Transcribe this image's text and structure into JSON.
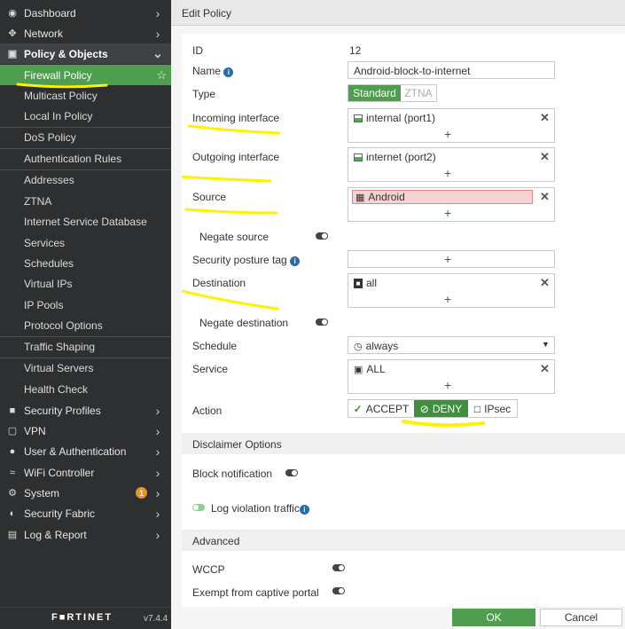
{
  "sidebar": {
    "top_items": [
      {
        "label": "Dashboard",
        "icon": "dashboard-icon"
      },
      {
        "label": "Network",
        "icon": "network-icon"
      },
      {
        "label": "Policy & Objects",
        "icon": "policy-icon"
      }
    ],
    "sub_items": [
      "Firewall Policy",
      "Multicast Policy",
      "Local In Policy",
      "DoS Policy",
      "Authentication Rules",
      "Addresses",
      "ZTNA",
      "Internet Service Database",
      "Services",
      "Schedules",
      "Virtual IPs",
      "IP Pools",
      "Protocol Options",
      "Traffic Shaping",
      "Virtual Servers",
      "Health Check"
    ],
    "bottom_items": [
      {
        "label": "Security Profiles",
        "icon": "lock-icon"
      },
      {
        "label": "VPN",
        "icon": "vpn-icon"
      },
      {
        "label": "User & Authentication",
        "icon": "user-icon"
      },
      {
        "label": "WiFi Controller",
        "icon": "wifi-icon"
      },
      {
        "label": "System",
        "icon": "gear-icon",
        "badge": "1"
      },
      {
        "label": "Security Fabric",
        "icon": "fabric-icon"
      },
      {
        "label": "Log & Report",
        "icon": "chart-icon"
      }
    ],
    "brand": "F■RTINET",
    "version": "v7.4.4"
  },
  "header": {
    "title": "Edit Policy"
  },
  "form": {
    "id_label": "ID",
    "id_value": "12",
    "name_label": "Name",
    "name_value": "Android-block-to-internet",
    "type_label": "Type",
    "type_options": [
      "Standard",
      "ZTNA"
    ],
    "type_selected": "Standard",
    "incoming_label": "Incoming interface",
    "incoming_value": "internal (port1)",
    "outgoing_label": "Outgoing interface",
    "outgoing_value": "internet (port2)",
    "source_label": "Source",
    "source_value": "Android",
    "negate_source_label": "Negate source",
    "posture_label": "Security posture tag",
    "destination_label": "Destination",
    "destination_value": "all",
    "negate_destination_label": "Negate destination",
    "schedule_label": "Schedule",
    "schedule_value": "always",
    "service_label": "Service",
    "service_value": "ALL",
    "action_label": "Action",
    "action_options": [
      "ACCEPT",
      "DENY",
      "IPsec"
    ],
    "action_selected": "DENY",
    "plus": "+",
    "remove": "✕"
  },
  "disclaimer": {
    "title": "Disclaimer Options",
    "block_notification_label": "Block notification",
    "log_violation_label": "Log violation traffic"
  },
  "advanced": {
    "title": "Advanced",
    "wccp_label": "WCCP",
    "captive_label": "Exempt from captive portal"
  },
  "footer": {
    "ok_label": "OK",
    "cancel_label": "Cancel"
  },
  "colors": {
    "accent_green": "#4f9d4f",
    "deny_green": "#3f8f3f",
    "source_error": "#f6d3d3",
    "highlight_marker": "#fff200"
  }
}
